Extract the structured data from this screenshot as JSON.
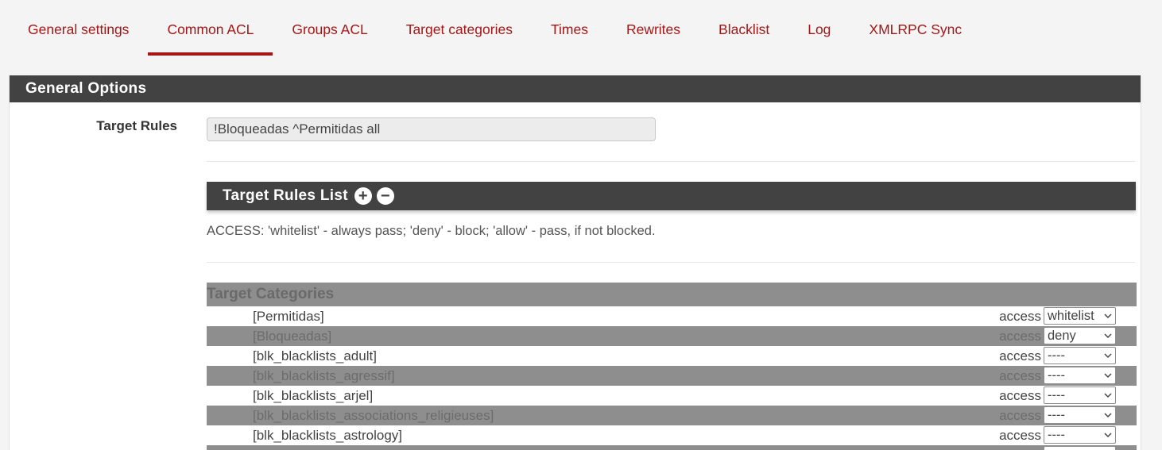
{
  "tabs": [
    {
      "label": "General settings",
      "active": false
    },
    {
      "label": "Common ACL",
      "active": true
    },
    {
      "label": "Groups ACL",
      "active": false
    },
    {
      "label": "Target categories",
      "active": false
    },
    {
      "label": "Times",
      "active": false
    },
    {
      "label": "Rewrites",
      "active": false
    },
    {
      "label": "Blacklist",
      "active": false
    },
    {
      "label": "Log",
      "active": false
    },
    {
      "label": "XMLRPC Sync",
      "active": false
    }
  ],
  "panel": {
    "title": "General Options",
    "target_rules_label": "Target Rules",
    "target_rules_value": "!Bloqueadas ^Permitidas all",
    "rules_list_title": "Target Rules List",
    "help_text": "ACCESS: 'whitelist' - always pass; 'deny' - block; 'allow' - pass, if not blocked."
  },
  "categories": {
    "header": "Target Categories",
    "access_label": "access",
    "rows": [
      {
        "name": "[Permitidas]",
        "value": "whitelist"
      },
      {
        "name": "[Bloqueadas]",
        "value": "deny"
      },
      {
        "name": "[blk_blacklists_adult]",
        "value": "----"
      },
      {
        "name": "[blk_blacklists_agressif]",
        "value": "----"
      },
      {
        "name": "[blk_blacklists_arjel]",
        "value": "----"
      },
      {
        "name": "[blk_blacklists_associations_religieuses]",
        "value": "----"
      },
      {
        "name": "[blk_blacklists_astrology]",
        "value": "----"
      },
      {
        "name": "",
        "value": "----"
      }
    ]
  },
  "colors": {
    "accent": "#a41717",
    "heading_bg": "#424242",
    "stripe": "#8e8e8e"
  }
}
